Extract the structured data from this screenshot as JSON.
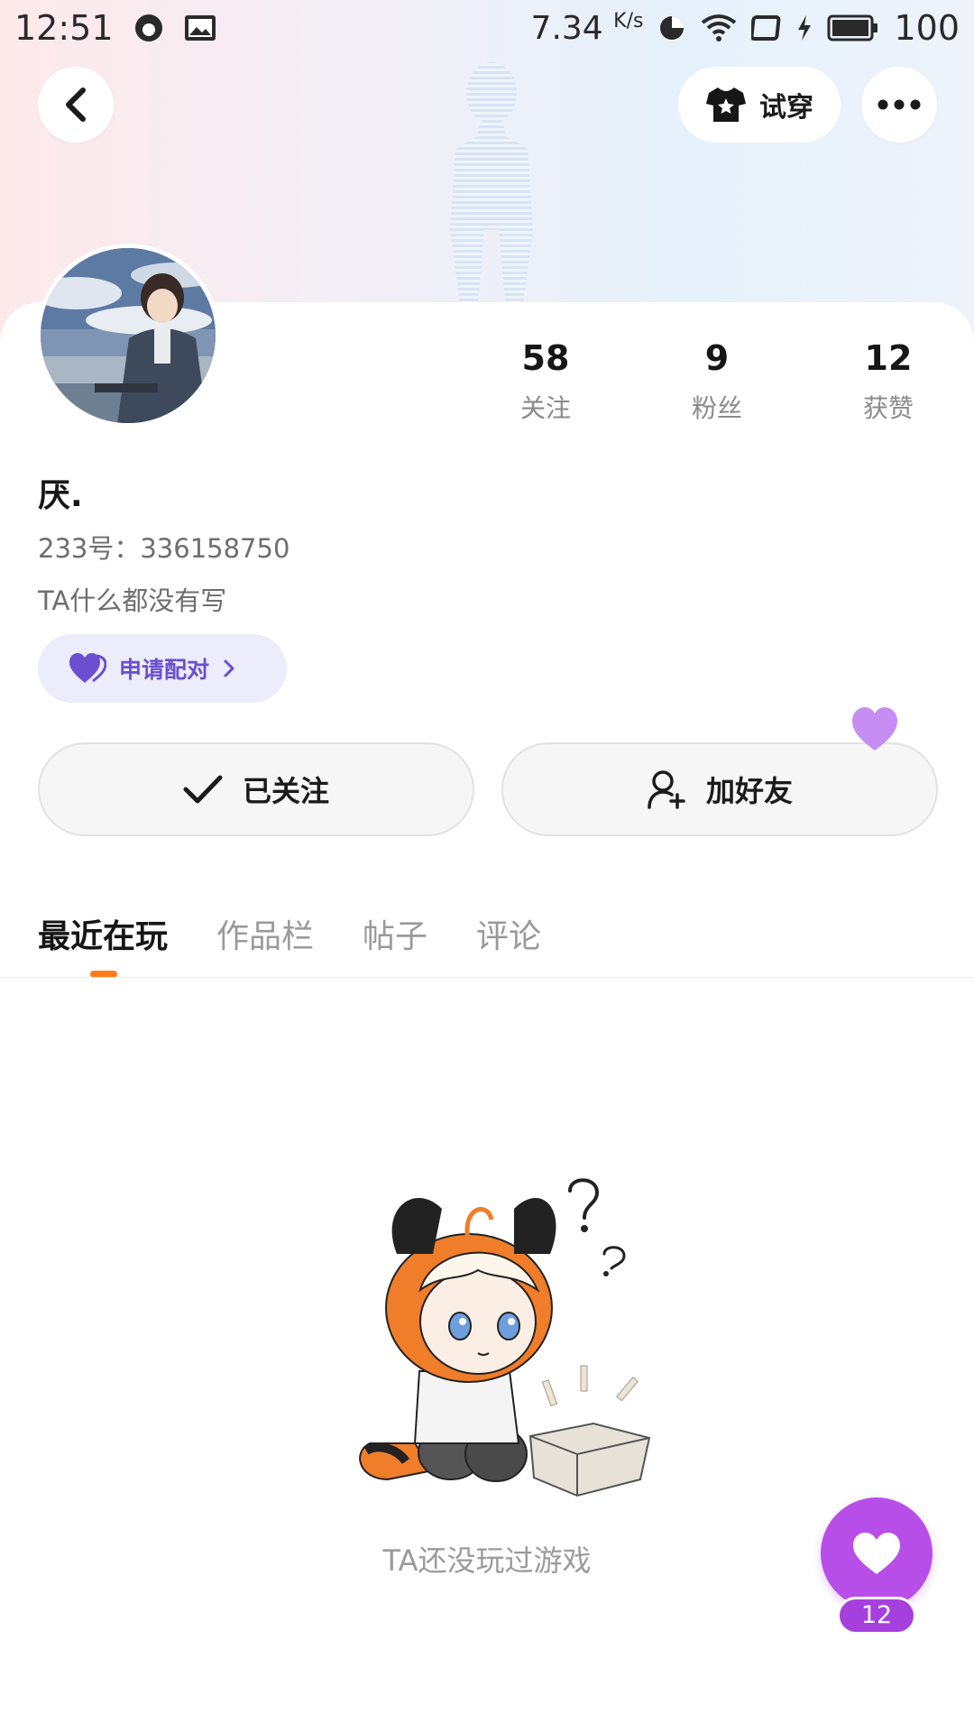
{
  "status_bar": {
    "time": "12:51",
    "net_speed": "7.34",
    "net_speed_unit": "K/s",
    "battery": "100",
    "icons": [
      "app-notification-icon",
      "gallery-notification-icon",
      "data-saver-icon",
      "wifi-icon",
      "screen-icon",
      "charging-icon",
      "battery-icon"
    ]
  },
  "header": {
    "tryon_label": "试穿",
    "icons": {
      "back": "chevron-left-icon",
      "tryon": "tshirt-icon",
      "more": "more-dots-icon"
    }
  },
  "profile": {
    "username": "厌.",
    "user_id": "233号：336158750",
    "bio": "TA什么都没有写",
    "pair_label": "申请配对",
    "stats": [
      {
        "value": "58",
        "label": "关注"
      },
      {
        "value": "9",
        "label": "粉丝"
      },
      {
        "value": "12",
        "label": "获赞"
      }
    ]
  },
  "actions": {
    "follow_label": "已关注",
    "add_friend_label": "加好友"
  },
  "tabs": [
    {
      "label": "最近在玩",
      "active": true
    },
    {
      "label": "作品栏",
      "active": false
    },
    {
      "label": "帖子",
      "active": false
    },
    {
      "label": "评论",
      "active": false
    }
  ],
  "empty_state": {
    "text": "TA还没玩过游戏"
  },
  "like_fab": {
    "count": "12"
  },
  "colors": {
    "accent_orange": "#ff7a1a",
    "accent_purple": "#b84ee8",
    "pair_text": "#6a4fd0",
    "pair_bg": "#ececfb"
  }
}
